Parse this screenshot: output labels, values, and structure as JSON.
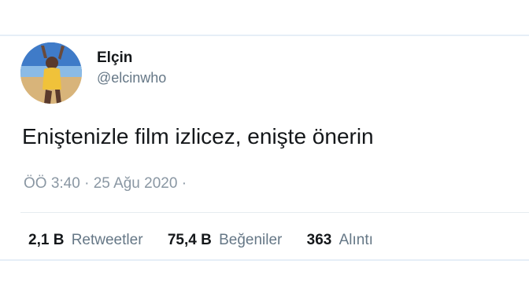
{
  "tweet": {
    "display_name": "Elçin",
    "handle": "@elcinwho",
    "text": "Eniştenizle film izlicez, enişte önerin",
    "meta": "ÖÖ 3:40 · 25 Ağu 2020 ·",
    "stats": {
      "retweets_count": "2,1 B",
      "retweets_label": "Retweetler",
      "likes_count": "75,4 B",
      "likes_label": "Beğeniler",
      "quotes_count": "363",
      "quotes_label": "Alıntı"
    }
  },
  "colors": {
    "text_primary": "#14171a",
    "text_secondary": "#657786",
    "border": "#e6eef7"
  }
}
